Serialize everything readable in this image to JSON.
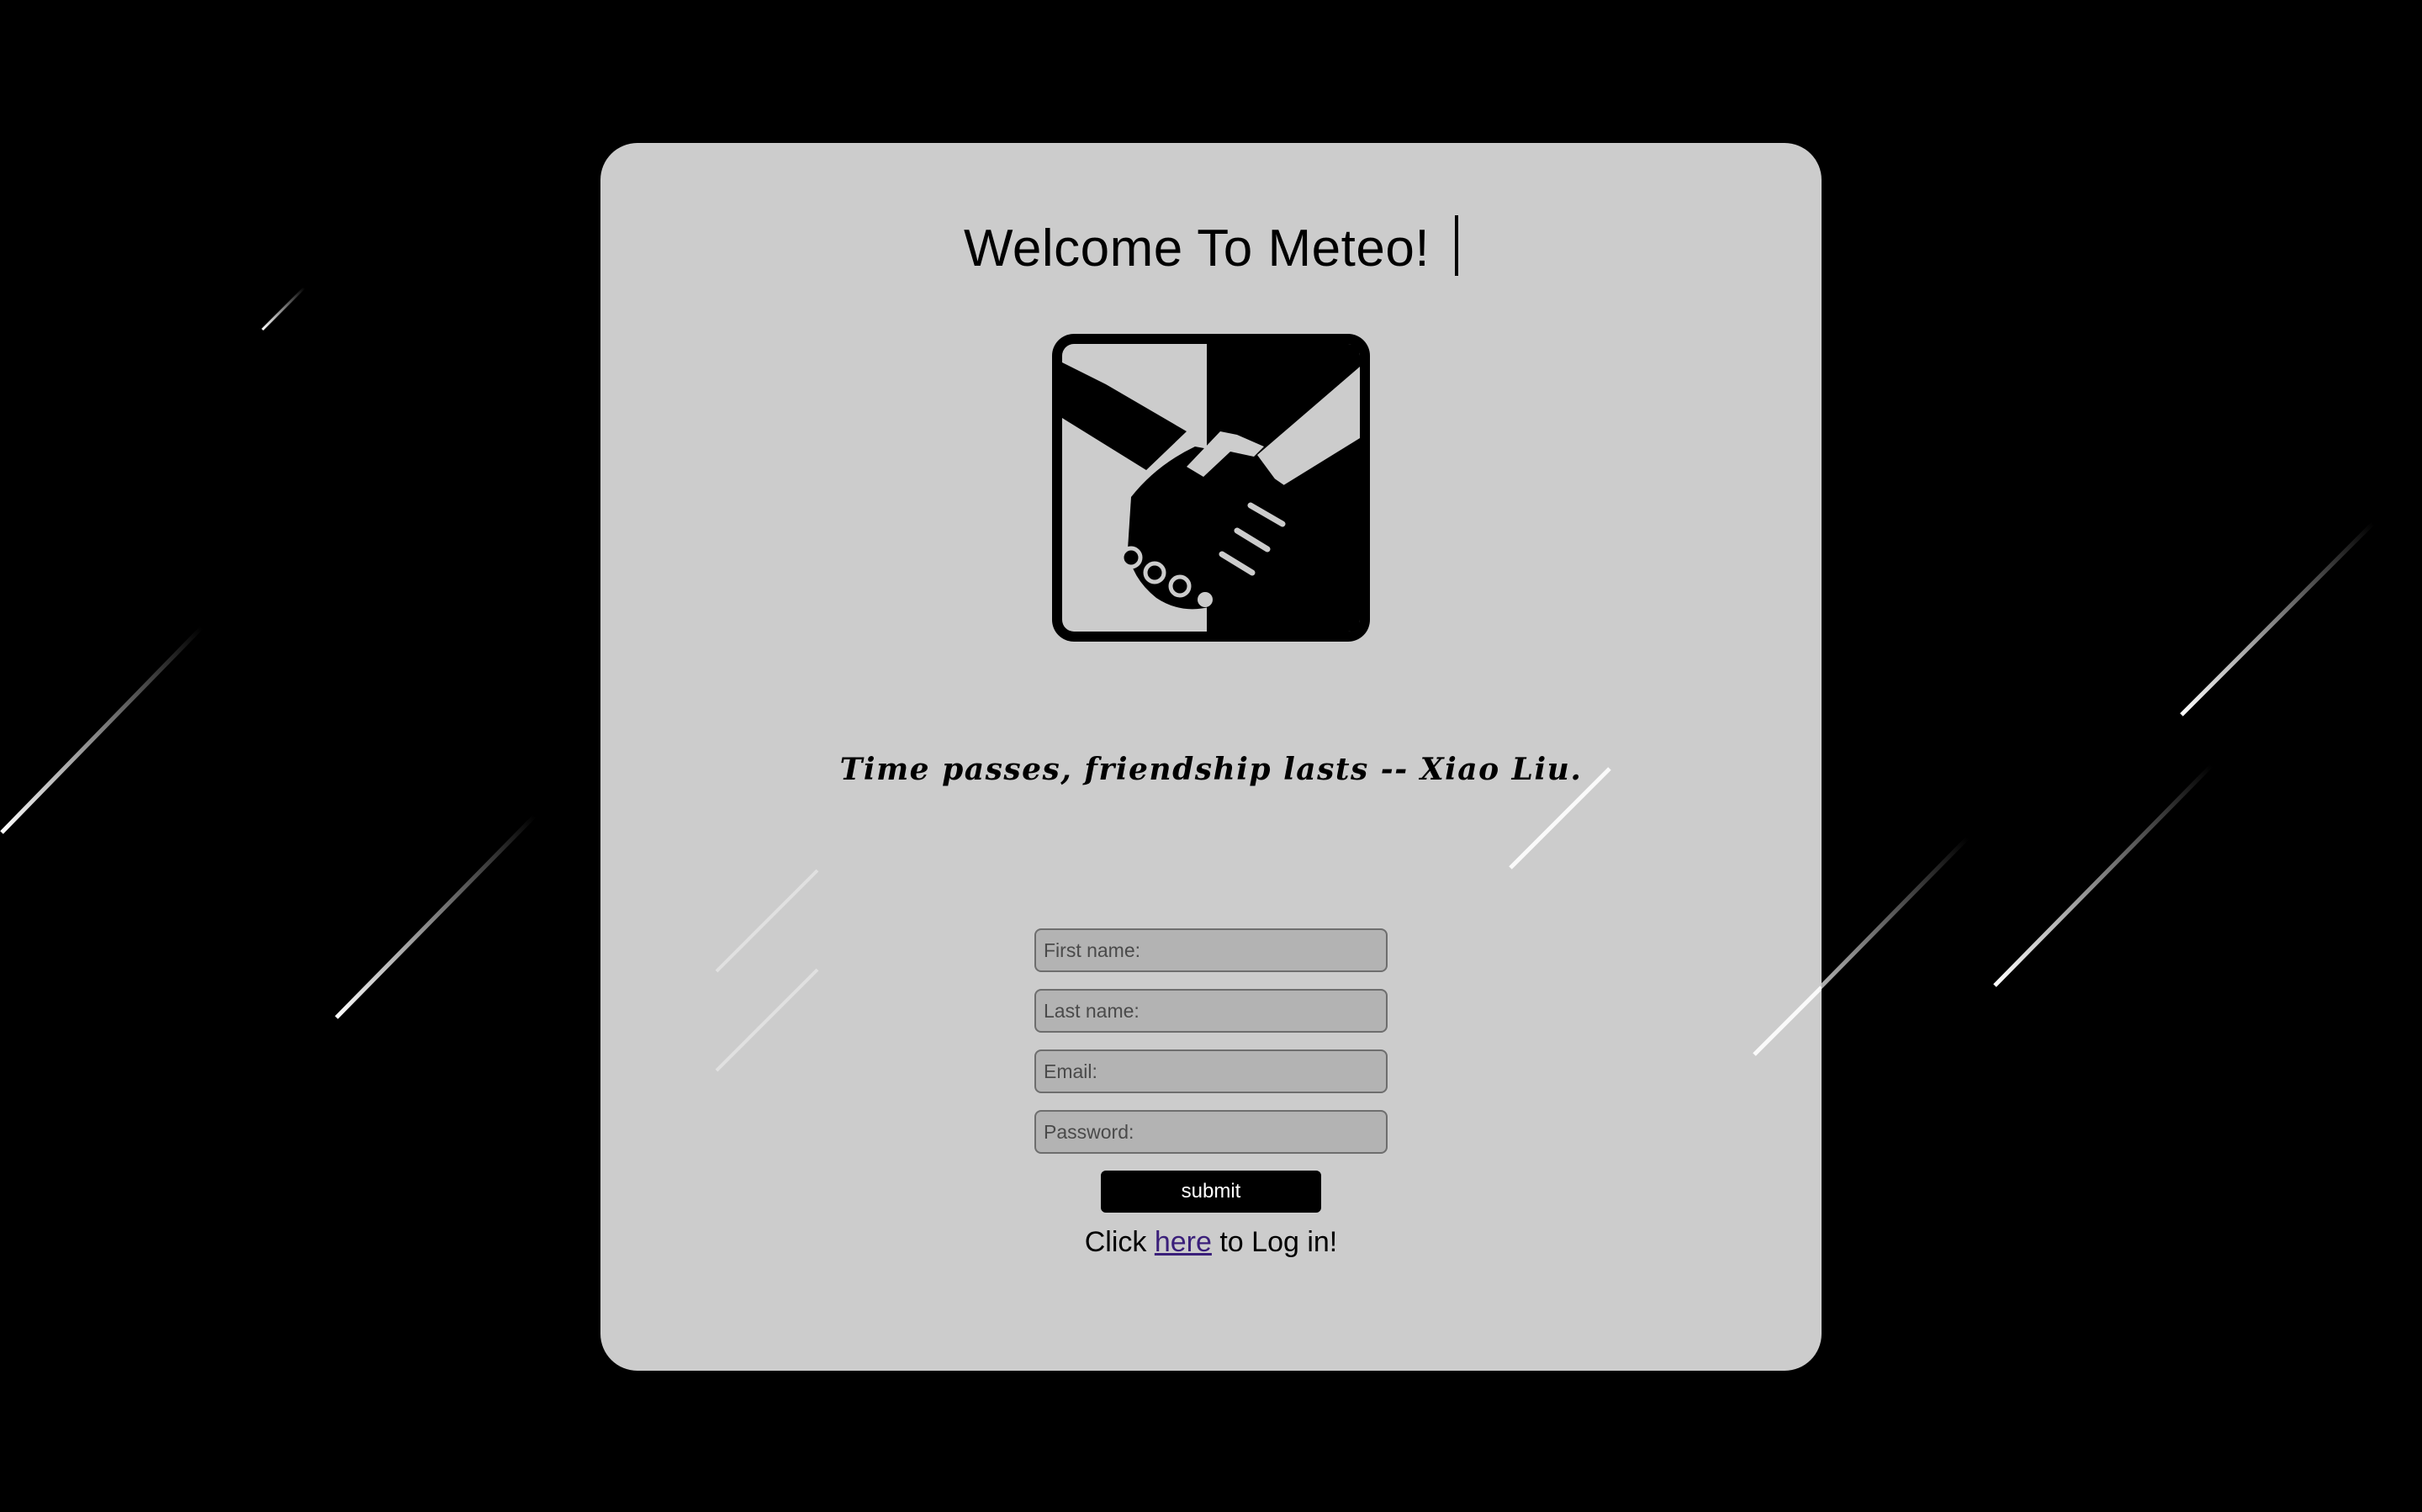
{
  "page": {
    "title": "Welcome To Meteo!",
    "motto": "Time passes, friendship lasts -- Xiao Liu."
  },
  "logo": {
    "icon": "handshake-icon"
  },
  "form": {
    "first_name_placeholder": "First name:",
    "last_name_placeholder": "Last name:",
    "email_placeholder": "Email:",
    "password_placeholder": "Password:",
    "submit_label": "submit"
  },
  "login": {
    "prefix": "Click ",
    "link_text": "here",
    "suffix": " to Log in!"
  },
  "colors": {
    "background": "#000000",
    "card": "#cccccc",
    "input_fill": "#b3b3b3",
    "button": "#000000",
    "link": "#3a1f7a"
  }
}
